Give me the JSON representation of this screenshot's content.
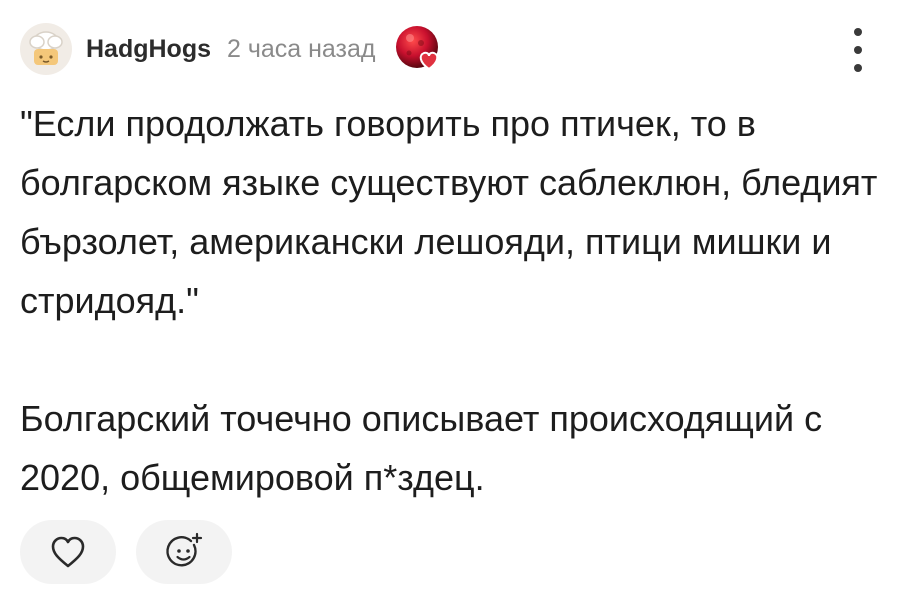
{
  "comment": {
    "author": "HadgHogs",
    "time_ago": "2 часа назад",
    "paragraph_1": "\"Если продолжать говорить про птичек, то в болгарском языке существуют саблеклюн, бледият бързолет, американски лешояди, птици мишки и стридояд.\"",
    "paragraph_2": "Болгарский точечно описывает происходящий с 2020, общемировой п*здец."
  },
  "icons": {
    "avatar": "chef-hat-avatar",
    "badge": "red-ball-heart-badge",
    "menu": "more-vertical-icon",
    "like": "heart-outline-icon",
    "react": "add-emoji-icon"
  },
  "colors": {
    "badge_red": "#c8102e",
    "heart_red": "#e0313f",
    "secondary_text": "#8a8a8a",
    "action_bg": "#f3f3f3"
  }
}
